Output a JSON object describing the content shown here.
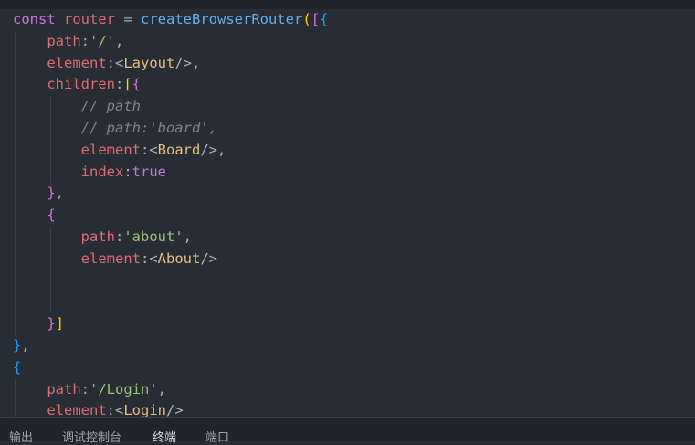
{
  "editor": {
    "lines": [
      {
        "indent": 0,
        "tokens": [
          {
            "t": "const ",
            "c": "kw"
          },
          {
            "t": "router",
            "c": "var"
          },
          {
            "t": " = ",
            "c": "plain"
          },
          {
            "t": "createBrowserRouter",
            "c": "fn"
          },
          {
            "t": "(",
            "c": "b1"
          },
          {
            "t": "[",
            "c": "b2"
          },
          {
            "t": "{",
            "c": "b3"
          }
        ]
      },
      {
        "indent": 1,
        "tokens": [
          {
            "t": "path",
            "c": "var"
          },
          {
            "t": ":",
            "c": "plain"
          },
          {
            "t": "'/'",
            "c": "str"
          },
          {
            "t": ",",
            "c": "plain"
          }
        ]
      },
      {
        "indent": 1,
        "tokens": [
          {
            "t": "element",
            "c": "var"
          },
          {
            "t": ":",
            "c": "plain"
          },
          {
            "t": "<",
            "c": "plain"
          },
          {
            "t": "Layout",
            "c": "tag"
          },
          {
            "t": "/>",
            "c": "plain"
          },
          {
            "t": ",",
            "c": "plain"
          }
        ]
      },
      {
        "indent": 1,
        "tokens": [
          {
            "t": "children",
            "c": "var"
          },
          {
            "t": ":",
            "c": "plain"
          },
          {
            "t": "[",
            "c": "b1"
          },
          {
            "t": "{",
            "c": "b2"
          }
        ]
      },
      {
        "indent": 2,
        "tokens": [
          {
            "t": "// path",
            "c": "cmt"
          }
        ]
      },
      {
        "indent": 2,
        "tokens": [
          {
            "t": "// path:'board',",
            "c": "cmt"
          }
        ]
      },
      {
        "indent": 2,
        "tokens": [
          {
            "t": "element",
            "c": "var"
          },
          {
            "t": ":",
            "c": "plain"
          },
          {
            "t": "<",
            "c": "plain"
          },
          {
            "t": "Board",
            "c": "tag"
          },
          {
            "t": "/>",
            "c": "plain"
          },
          {
            "t": ",",
            "c": "plain"
          }
        ]
      },
      {
        "indent": 2,
        "tokens": [
          {
            "t": "index",
            "c": "var"
          },
          {
            "t": ":",
            "c": "plain"
          },
          {
            "t": "true",
            "c": "kw"
          }
        ]
      },
      {
        "indent": 1,
        "tokens": [
          {
            "t": "}",
            "c": "b2"
          },
          {
            "t": ",",
            "c": "plain"
          }
        ]
      },
      {
        "indent": 1,
        "tokens": [
          {
            "t": "{",
            "c": "b2"
          }
        ]
      },
      {
        "indent": 2,
        "tokens": [
          {
            "t": "path",
            "c": "var"
          },
          {
            "t": ":",
            "c": "plain"
          },
          {
            "t": "'about'",
            "c": "str"
          },
          {
            "t": ",",
            "c": "plain"
          }
        ]
      },
      {
        "indent": 2,
        "tokens": [
          {
            "t": "element",
            "c": "var"
          },
          {
            "t": ":",
            "c": "plain"
          },
          {
            "t": "<",
            "c": "plain"
          },
          {
            "t": "About",
            "c": "tag"
          },
          {
            "t": "/>",
            "c": "plain"
          }
        ]
      },
      {
        "indent": 2,
        "tokens": []
      },
      {
        "indent": 2,
        "tokens": []
      },
      {
        "indent": 1,
        "tokens": [
          {
            "t": "}",
            "c": "b2"
          },
          {
            "t": "]",
            "c": "b1"
          }
        ]
      },
      {
        "indent": 0,
        "tokens": [
          {
            "t": "}",
            "c": "b3"
          },
          {
            "t": ",",
            "c": "plain"
          }
        ]
      },
      {
        "indent": 0,
        "tokens": [
          {
            "t": "{",
            "c": "b3"
          }
        ]
      },
      {
        "indent": 1,
        "tokens": [
          {
            "t": "path",
            "c": "var"
          },
          {
            "t": ":",
            "c": "plain"
          },
          {
            "t": "'/Login'",
            "c": "str"
          },
          {
            "t": ",",
            "c": "plain"
          }
        ]
      },
      {
        "indent": 1,
        "tokens": [
          {
            "t": "element",
            "c": "var"
          },
          {
            "t": ":",
            "c": "plain"
          },
          {
            "t": "<",
            "c": "plain"
          },
          {
            "t": "Login",
            "c": "tag"
          },
          {
            "t": "/>",
            "c": "plain"
          }
        ]
      }
    ]
  },
  "panel": {
    "tabs": [
      {
        "label": "输出",
        "active": false
      },
      {
        "label": "调试控制台",
        "active": false
      },
      {
        "label": "终端",
        "active": true
      },
      {
        "label": "端口",
        "active": false
      }
    ]
  }
}
